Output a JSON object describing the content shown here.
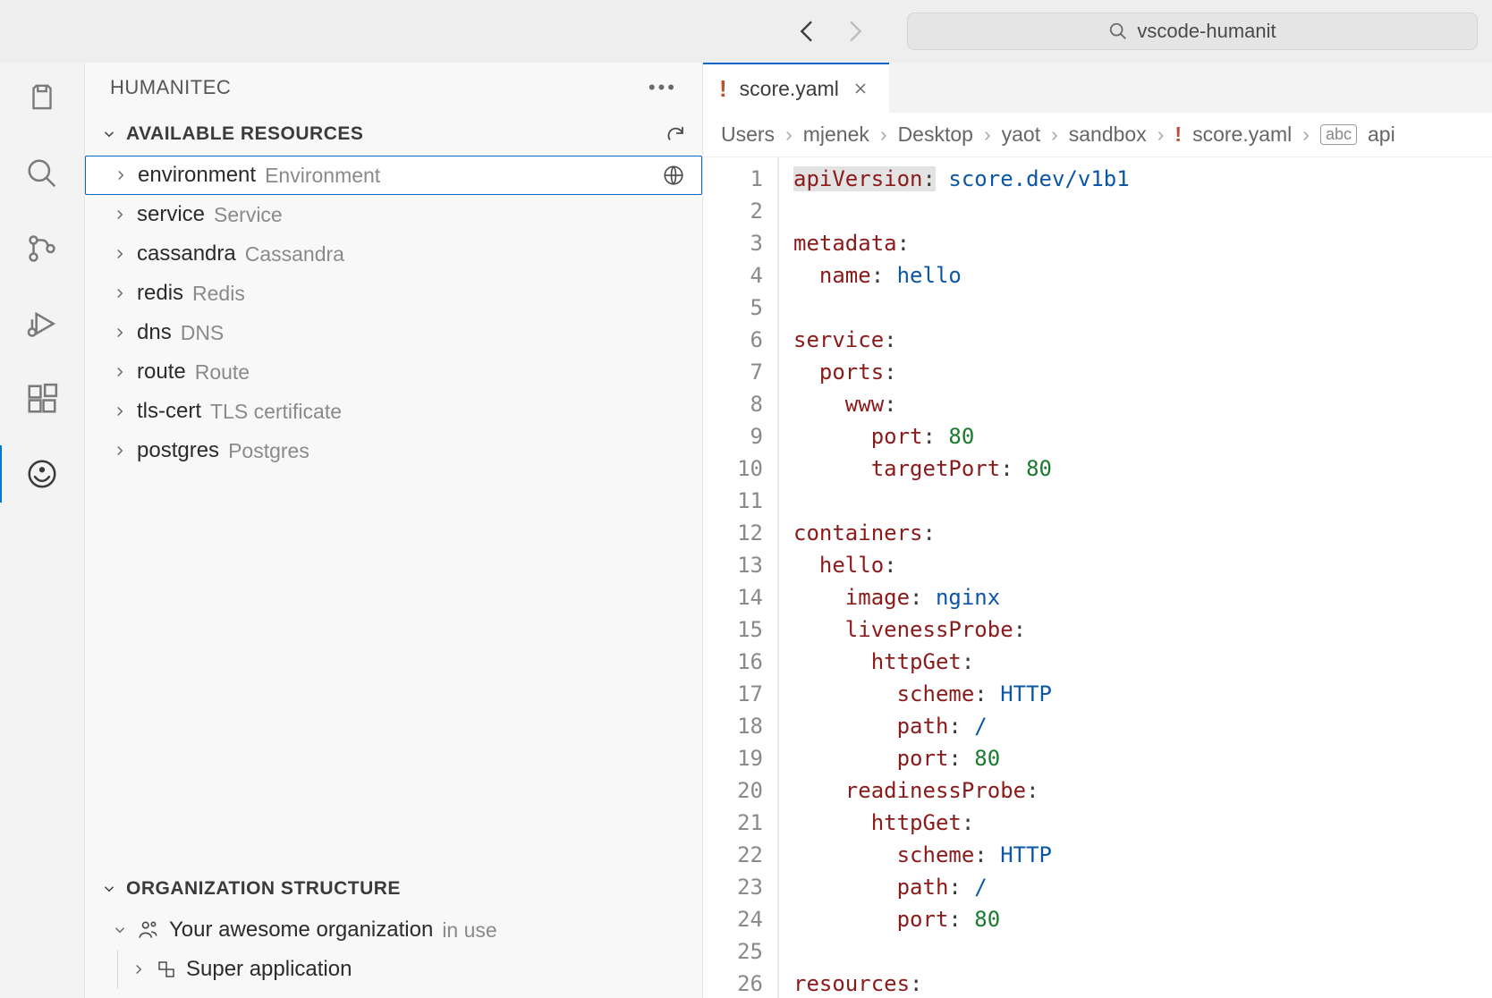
{
  "titlebar": {
    "search_text": "vscode-humanit"
  },
  "sidebar": {
    "title": "HUMANITEC",
    "resources_section": "AVAILABLE RESOURCES",
    "resources": [
      {
        "name": "environment",
        "desc": "Environment",
        "selected": true,
        "icon": "globe"
      },
      {
        "name": "service",
        "desc": "Service"
      },
      {
        "name": "cassandra",
        "desc": "Cassandra"
      },
      {
        "name": "redis",
        "desc": "Redis"
      },
      {
        "name": "dns",
        "desc": "DNS"
      },
      {
        "name": "route",
        "desc": "Route"
      },
      {
        "name": "tls-cert",
        "desc": "TLS certificate"
      },
      {
        "name": "postgres",
        "desc": "Postgres"
      }
    ],
    "org_section": "ORGANIZATION STRUCTURE",
    "org": {
      "name": "Your awesome organization",
      "badge": "in use",
      "child": "Super application"
    }
  },
  "editor": {
    "tab_filename": "score.yaml",
    "breadcrumbs": [
      "Users",
      "mjenek",
      "Desktop",
      "yaot",
      "sandbox",
      "score.yaml",
      "api"
    ],
    "code_lines": [
      {
        "n": 1,
        "tokens": [
          [
            "key hl",
            "apiVersion"
          ],
          [
            "hl",
            ":"
          ],
          [
            "",
            " "
          ],
          [
            "val",
            "score.dev/v1b1"
          ]
        ]
      },
      {
        "n": 2,
        "tokens": []
      },
      {
        "n": 3,
        "tokens": [
          [
            "key",
            "metadata"
          ],
          [
            "",
            ":"
          ]
        ]
      },
      {
        "n": 4,
        "tokens": [
          [
            "",
            "  "
          ],
          [
            "key",
            "name"
          ],
          [
            "",
            ":"
          ],
          [
            "",
            " "
          ],
          [
            "val",
            "hello"
          ]
        ]
      },
      {
        "n": 5,
        "tokens": []
      },
      {
        "n": 6,
        "tokens": [
          [
            "key",
            "service"
          ],
          [
            "",
            ":"
          ]
        ]
      },
      {
        "n": 7,
        "tokens": [
          [
            "",
            "  "
          ],
          [
            "key",
            "ports"
          ],
          [
            "",
            ":"
          ]
        ]
      },
      {
        "n": 8,
        "tokens": [
          [
            "",
            "    "
          ],
          [
            "key",
            "www"
          ],
          [
            "",
            ":"
          ]
        ]
      },
      {
        "n": 9,
        "tokens": [
          [
            "",
            "      "
          ],
          [
            "key",
            "port"
          ],
          [
            "",
            ":"
          ],
          [
            "",
            " "
          ],
          [
            "num",
            "80"
          ]
        ]
      },
      {
        "n": 10,
        "tokens": [
          [
            "",
            "      "
          ],
          [
            "key",
            "targetPort"
          ],
          [
            "",
            ":"
          ],
          [
            "",
            " "
          ],
          [
            "num",
            "80"
          ]
        ]
      },
      {
        "n": 11,
        "tokens": []
      },
      {
        "n": 12,
        "tokens": [
          [
            "key",
            "containers"
          ],
          [
            "",
            ":"
          ]
        ]
      },
      {
        "n": 13,
        "tokens": [
          [
            "",
            "  "
          ],
          [
            "key",
            "hello"
          ],
          [
            "",
            ":"
          ]
        ]
      },
      {
        "n": 14,
        "tokens": [
          [
            "",
            "    "
          ],
          [
            "key",
            "image"
          ],
          [
            "",
            ":"
          ],
          [
            "",
            " "
          ],
          [
            "val",
            "nginx"
          ]
        ]
      },
      {
        "n": 15,
        "tokens": [
          [
            "",
            "    "
          ],
          [
            "key",
            "livenessProbe"
          ],
          [
            "",
            ":"
          ]
        ]
      },
      {
        "n": 16,
        "tokens": [
          [
            "",
            "      "
          ],
          [
            "key",
            "httpGet"
          ],
          [
            "",
            ":"
          ]
        ]
      },
      {
        "n": 17,
        "tokens": [
          [
            "",
            "        "
          ],
          [
            "key",
            "scheme"
          ],
          [
            "",
            ":"
          ],
          [
            "",
            " "
          ],
          [
            "val",
            "HTTP"
          ]
        ]
      },
      {
        "n": 18,
        "tokens": [
          [
            "",
            "        "
          ],
          [
            "key",
            "path"
          ],
          [
            "",
            ":"
          ],
          [
            "",
            " "
          ],
          [
            "val",
            "/"
          ]
        ]
      },
      {
        "n": 19,
        "tokens": [
          [
            "",
            "        "
          ],
          [
            "key",
            "port"
          ],
          [
            "",
            ":"
          ],
          [
            "",
            " "
          ],
          [
            "num",
            "80"
          ]
        ]
      },
      {
        "n": 20,
        "tokens": [
          [
            "",
            "    "
          ],
          [
            "key",
            "readinessProbe"
          ],
          [
            "",
            ":"
          ]
        ]
      },
      {
        "n": 21,
        "tokens": [
          [
            "",
            "      "
          ],
          [
            "key",
            "httpGet"
          ],
          [
            "",
            ":"
          ]
        ]
      },
      {
        "n": 22,
        "tokens": [
          [
            "",
            "        "
          ],
          [
            "key",
            "scheme"
          ],
          [
            "",
            ":"
          ],
          [
            "",
            " "
          ],
          [
            "val",
            "HTTP"
          ]
        ]
      },
      {
        "n": 23,
        "tokens": [
          [
            "",
            "        "
          ],
          [
            "key",
            "path"
          ],
          [
            "",
            ":"
          ],
          [
            "",
            " "
          ],
          [
            "val",
            "/"
          ]
        ]
      },
      {
        "n": 24,
        "tokens": [
          [
            "",
            "        "
          ],
          [
            "key",
            "port"
          ],
          [
            "",
            ":"
          ],
          [
            "",
            " "
          ],
          [
            "num",
            "80"
          ]
        ]
      },
      {
        "n": 25,
        "tokens": []
      },
      {
        "n": 26,
        "tokens": [
          [
            "key",
            "resources"
          ],
          [
            "",
            ":"
          ]
        ]
      }
    ]
  }
}
